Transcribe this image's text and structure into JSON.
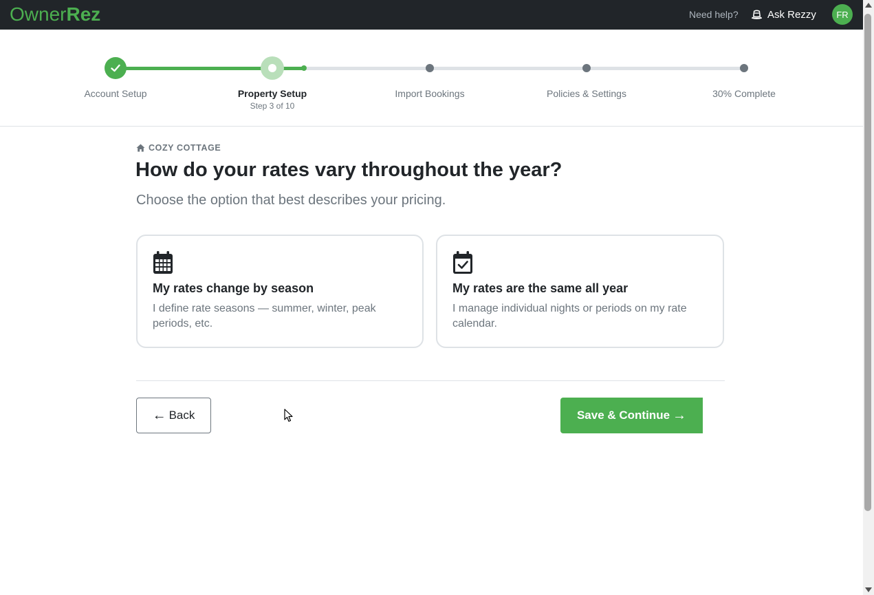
{
  "app": {
    "logo_regular": "Owner",
    "logo_bold": "Rez",
    "brand_color": "#4caf50"
  },
  "topbar": {
    "need_help": "Need help?",
    "ask_rezzy": "Ask Rezzy",
    "ask_rezzy_icon": "hat-icon",
    "avatar_initials": "FR"
  },
  "stepper": {
    "progress_percent": 30,
    "steps": [
      {
        "label": "Account Setup",
        "status": "complete"
      },
      {
        "label": "Property Setup",
        "sub": "Step 3 of 10",
        "status": "current"
      },
      {
        "label": "Import Bookings",
        "status": "upcoming"
      },
      {
        "label": "Policies & Settings",
        "status": "upcoming"
      },
      {
        "label": "30% Complete",
        "status": "upcoming"
      }
    ]
  },
  "main": {
    "property_icon": "home-icon",
    "property_name": "COZY COTTAGE",
    "title": "How do your rates vary throughout the year?",
    "subtitle": "Choose the option that best describes your pricing.",
    "options": [
      {
        "icon": "calendar-grid-icon",
        "title": "My rates change by season",
        "description": "I define rate seasons — summer, winter, peak periods, etc."
      },
      {
        "icon": "calendar-check-icon",
        "title": "My rates are the same all year",
        "description": "I manage individual nights or periods on my rate calendar."
      }
    ]
  },
  "actions": {
    "back_label": "Back",
    "back_arrow": "←",
    "save_label": "Save & Continue",
    "save_arrow": "→"
  }
}
